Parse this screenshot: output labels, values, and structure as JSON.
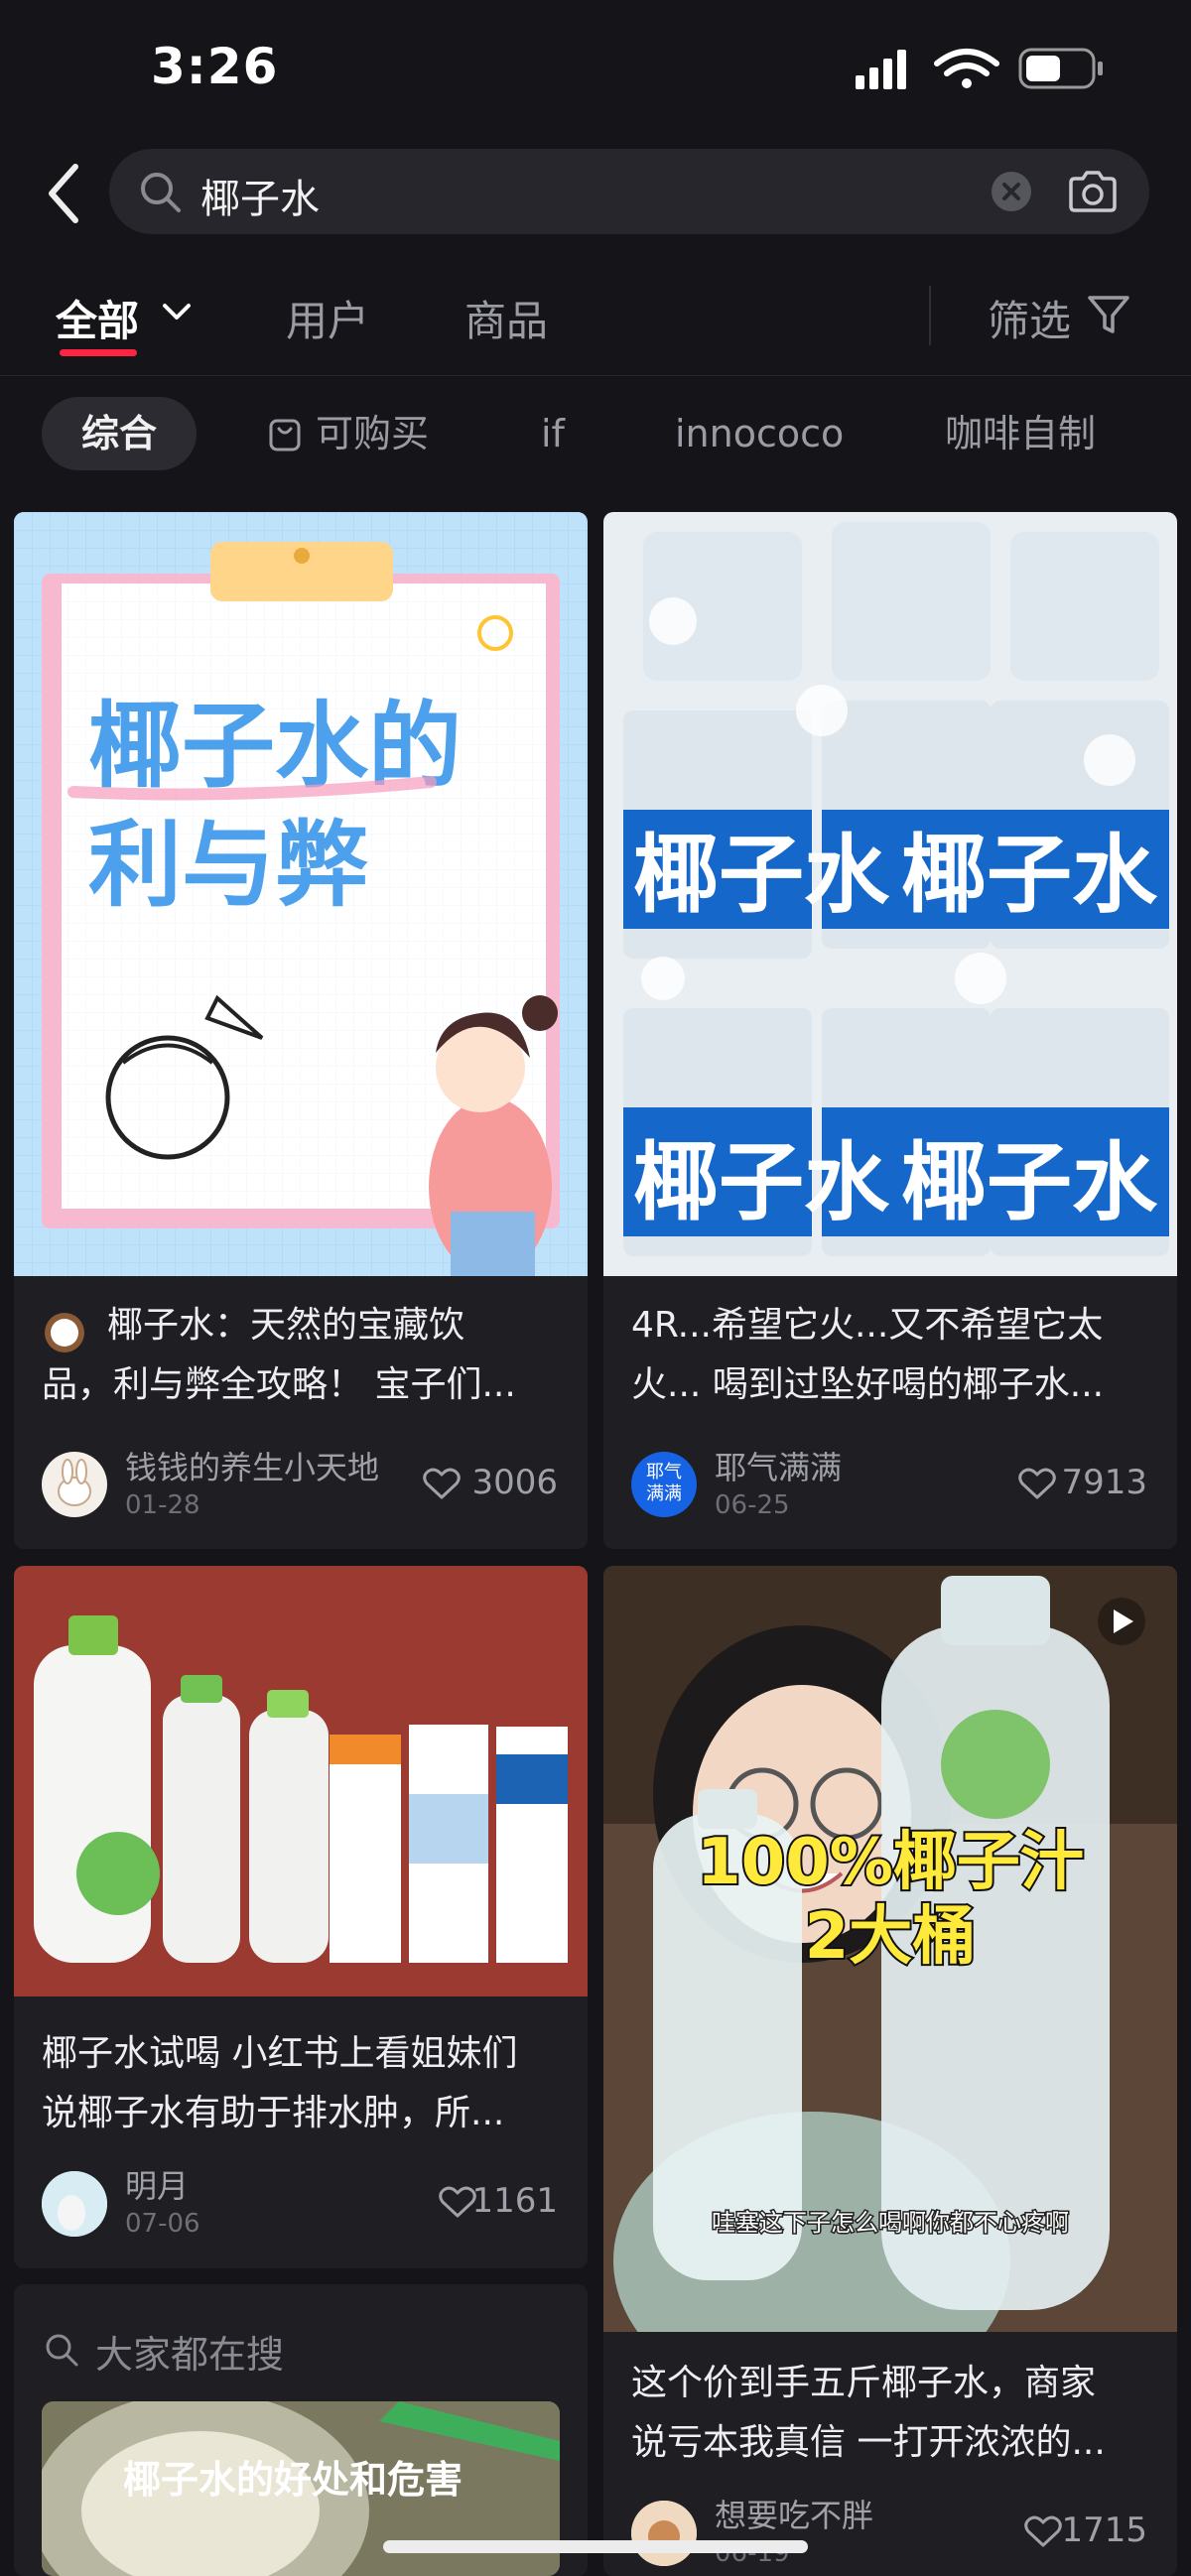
{
  "status_bar": {
    "time": "3:26"
  },
  "search": {
    "query": "椰子水"
  },
  "tabs": {
    "all": "全部",
    "users": "用户",
    "goods": "商品",
    "filter": "筛选"
  },
  "chips": [
    "综合",
    "可购买",
    "if",
    "innococo",
    "咖啡自制"
  ],
  "cards": [
    {
      "image_text_line1": "椰子水的",
      "image_text_line2": "利与弊",
      "title_line1": "椰子水：天然的宝藏饮",
      "title_line2": "品，利与弊全攻略！ 宝子们...",
      "author": "钱钱的养生小天地",
      "date": "01-28",
      "likes": "3006"
    },
    {
      "image_text": "椰子水",
      "title_line1": "4R...希望它火...又不希望它太",
      "title_line2": "火... 喝到过坠好喝的椰子水...",
      "author": "耶气满满",
      "avatar_text": "耶气\n满满",
      "date": "06-25",
      "likes": "7913"
    },
    {
      "title_line1": "椰子水试喝 小红书上看姐妹们",
      "title_line2": "说椰子水有助于排水肿，所...",
      "author": "明月",
      "date": "07-06",
      "likes": "1161"
    },
    {
      "image_caption_big_1": "100%椰子汁",
      "image_caption_big_2": "2大桶",
      "image_subtitle": "哇塞这下子怎么喝啊你都不心疼啊",
      "title_line1": "这个价到手五斤椰子水，商家",
      "title_line2": "说亏本我真信 一打开浓浓的...",
      "author": "想要吃不胖",
      "date": "06-19",
      "likes": "1715"
    }
  ],
  "trending": {
    "header": "大家都在搜",
    "item": "椰子水的好处和危害"
  }
}
